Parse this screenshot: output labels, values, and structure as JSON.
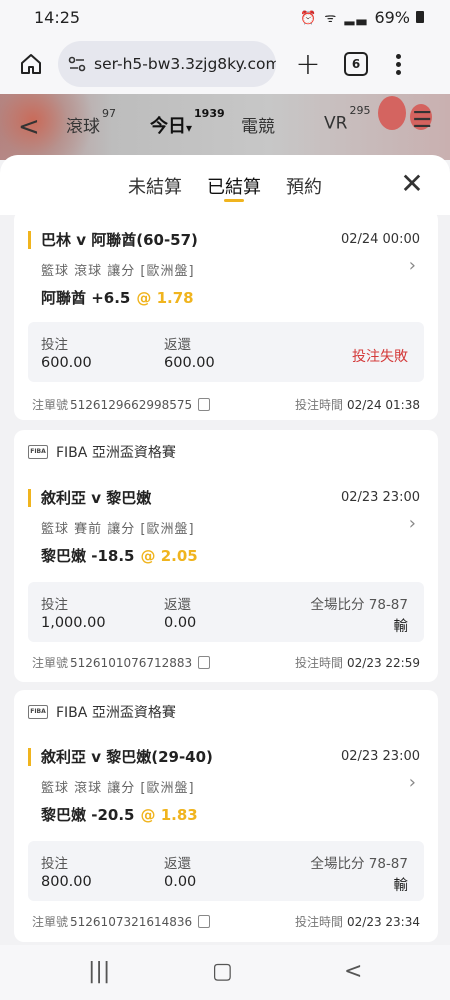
{
  "status_bar": {
    "time": "14:25",
    "icons": "⏰ ᯤ ▂▃",
    "battery": "69%"
  },
  "browser": {
    "url": "ser-h5-bw3.3zjg8ky.com",
    "tab_count": "6",
    "plus": "+"
  },
  "app_header": {
    "back": "<",
    "nav": [
      {
        "label": "滾球",
        "count": "97"
      },
      {
        "label": "今日",
        "count": "1939",
        "arrow": "▾"
      },
      {
        "label": "電競",
        "count": ""
      },
      {
        "label": "VR",
        "count": "295"
      }
    ],
    "menu": "☰"
  },
  "sheet": {
    "tabs": [
      {
        "label": "未結算"
      },
      {
        "label": "已結算"
      },
      {
        "label": "預約"
      }
    ],
    "close": "✕"
  },
  "bets": [
    {
      "league": "",
      "title": "巴林 v 阿聯酋(60-57)",
      "time": "02/24 00:00",
      "type": "籃球  滾球  讓分  [歐洲盤]",
      "pick": "阿聯酋 +6.5",
      "odds": "@ 1.78",
      "stake_label": "投注",
      "stake": "600.00",
      "return_label": "返還",
      "return": "600.00",
      "status": "投注失敗",
      "score_label": "",
      "result": "",
      "bet_no_label": "注單號",
      "bet_no": "5126129662998575",
      "bet_time_label": "投注時間",
      "bet_time": "02/24 01:38"
    },
    {
      "league": "FIBA 亞洲盃資格賽",
      "logo": "FIBA",
      "title": "敘利亞 v 黎巴嫩",
      "time": "02/23 23:00",
      "type": "籃球  賽前  讓分  [歐洲盤]",
      "pick": "黎巴嫩 -18.5",
      "odds": "@ 2.05",
      "stake_label": "投注",
      "stake": "1,000.00",
      "return_label": "返還",
      "return": "0.00",
      "status": "",
      "score_label": "全場比分 78-87",
      "result": "輸",
      "bet_no_label": "注單號",
      "bet_no": "5126101076712883",
      "bet_time_label": "投注時間",
      "bet_time": "02/23 22:59"
    },
    {
      "league": "FIBA 亞洲盃資格賽",
      "logo": "FIBA",
      "title": "敘利亞 v 黎巴嫩(29-40)",
      "time": "02/23 23:00",
      "type": "籃球  滾球  讓分  [歐洲盤]",
      "pick": "黎巴嫩 -20.5",
      "odds": "@ 1.83",
      "stake_label": "投注",
      "stake": "800.00",
      "return_label": "返還",
      "return": "0.00",
      "status": "",
      "score_label": "全場比分 78-87",
      "result": "輸",
      "bet_no_label": "注單號",
      "bet_no": "5126107321614836",
      "bet_time_label": "投注時間",
      "bet_time": "02/23 23:34"
    }
  ],
  "nav_bar": {
    "recents": "|||",
    "home": "▢",
    "back": "<"
  }
}
